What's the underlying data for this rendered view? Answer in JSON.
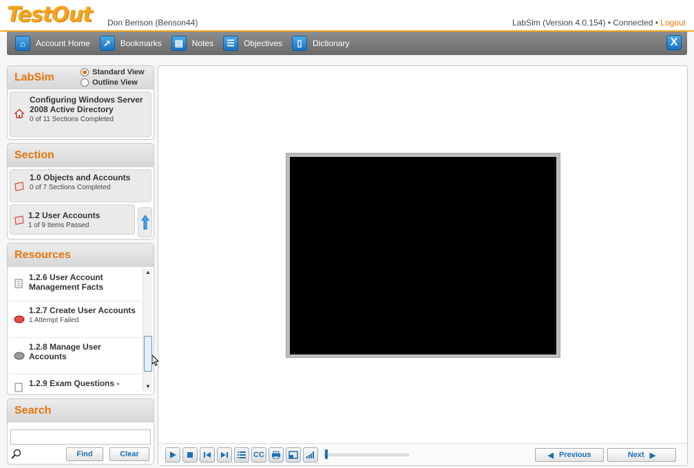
{
  "header": {
    "logo": "TestOut",
    "user": "Don Benson (Benson44)",
    "version": "LabSim (Version 4.0.154)",
    "connection": "Connected",
    "separator": "•",
    "logout": "Logout"
  },
  "nav": {
    "items": [
      {
        "label": "Account Home",
        "icon": "home-icon"
      },
      {
        "label": "Bookmarks",
        "icon": "bookmark-icon"
      },
      {
        "label": "Notes",
        "icon": "notes-icon"
      },
      {
        "label": "Objectives",
        "icon": "list-icon"
      },
      {
        "label": "Dictionary",
        "icon": "dictionary-icon"
      }
    ],
    "close_label": "X"
  },
  "labsim": {
    "title": "LabSim",
    "view_standard": "Standard View",
    "view_outline": "Outline View",
    "course_title": "Configuring Windows Server 2008 Active Directory",
    "course_sub": "0 of 11 Sections Completed"
  },
  "section": {
    "title": "Section",
    "item1_title": "1.0 Objects and Accounts",
    "item1_sub": "0 of 7 Sections Completed",
    "item2_title": "1.2 User Accounts",
    "item2_sub": "1 of 9 Items Passed"
  },
  "resources": {
    "title": "Resources",
    "items": [
      {
        "title": "1.2.6 User Account Management Facts",
        "sub": ""
      },
      {
        "title": "1.2.7 Create User Accounts",
        "sub": "1 Attempt Failed"
      },
      {
        "title": "1.2.8 Manage User Accounts",
        "sub": ""
      },
      {
        "title": "1.2.9 Exam Questions -",
        "sub": ""
      }
    ]
  },
  "search": {
    "title": "Search",
    "find": "Find",
    "clear": "Clear",
    "value": ""
  },
  "player": {
    "previous": "Previous",
    "next": "Next",
    "cc": "CC",
    "progress": 0.0
  },
  "colors": {
    "accent": "#e8740c",
    "logo": "#f7a21b",
    "link": "#1a6fb8"
  }
}
